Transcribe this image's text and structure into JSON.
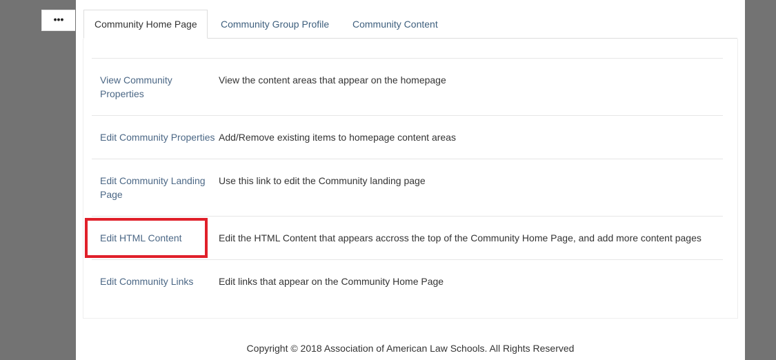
{
  "toolbar": {
    "more_label": "•••"
  },
  "tabs": [
    {
      "label": "Community Home Page",
      "active": true
    },
    {
      "label": "Community Group Profile",
      "active": false
    },
    {
      "label": "Community Content",
      "active": false
    }
  ],
  "rows": [
    {
      "link": "View Community Properties",
      "description": "View the content areas that appear on the homepage"
    },
    {
      "link": "Edit Community Properties",
      "description": "Add/Remove existing items to homepage content areas"
    },
    {
      "link": "Edit Community Landing Page",
      "description": "Use this link to edit the Community landing page"
    },
    {
      "link": "Edit HTML Content",
      "description": "Edit the HTML Content that appears accross the top of the Community Home Page, and add more content pages"
    },
    {
      "link": "Edit Community Links",
      "description": "Edit links that appear on the Community Home Page"
    }
  ],
  "footer": {
    "copyright": "Copyright © 2018 Association of American Law Schools. All Rights Reserved"
  },
  "colors": {
    "highlight": "#e0202a",
    "link": "#4b6785",
    "background": "#737373"
  }
}
